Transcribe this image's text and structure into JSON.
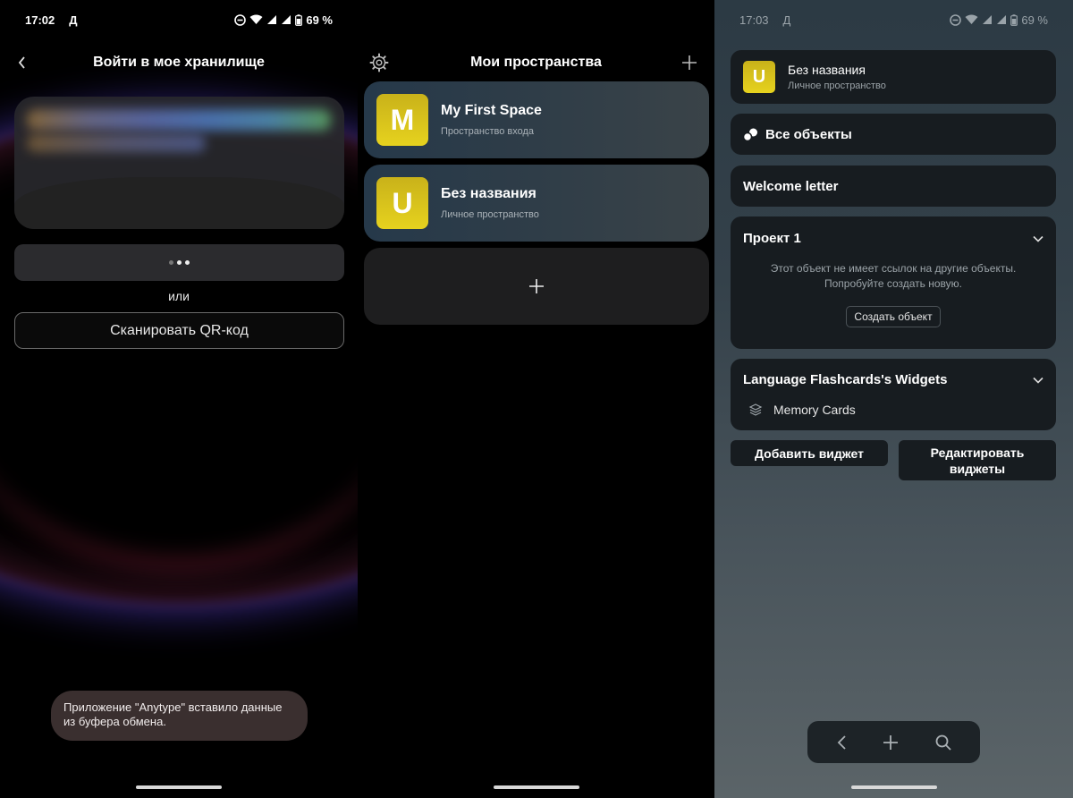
{
  "screen1": {
    "status": {
      "time": "17:02",
      "carrier": "Д",
      "battery": "69 %"
    },
    "header": {
      "title": "Войти в мое хранилище",
      "back_icon": "chevron-left-icon"
    },
    "or_label": "или",
    "qr_button": "Сканировать QR-код",
    "toast": "Приложение \"Anytype\" вставило данные из буфера обмена."
  },
  "screen2": {
    "header": {
      "title": "Мои пространства",
      "settings_icon": "gear-icon",
      "add_icon": "plus-icon"
    },
    "spaces": [
      {
        "letter": "M",
        "name": "My First Space",
        "subtitle": "Пространство входа"
      },
      {
        "letter": "U",
        "name": "Без названия",
        "subtitle": "Личное пространство"
      }
    ],
    "add_space_icon": "plus-icon"
  },
  "screen3": {
    "status": {
      "time": "17:03",
      "carrier": "Д",
      "battery": "69 %"
    },
    "space": {
      "letter": "U",
      "name": "Без названия",
      "subtitle": "Личное пространство"
    },
    "all_objects": "Все объекты",
    "welcome": "Welcome letter",
    "project": {
      "title": "Проект 1",
      "empty_line1": "Этот объект не имеет ссылок на другие объекты.",
      "empty_line2": "Попробуйте создать новую.",
      "create_button": "Создать объект"
    },
    "widgets": {
      "title": "Language Flashcards's Widgets",
      "item": "Memory Cards"
    },
    "add_widget": "Добавить виджет",
    "edit_widgets_line1": "Редактировать",
    "edit_widgets_line2": "виджеты",
    "nav": {
      "back_icon": "chevron-left-icon",
      "add_icon": "plus-icon",
      "search_icon": "search-icon"
    }
  },
  "colors": {
    "accent_avatar": "#e0cb1e",
    "card_bg": "#171c20"
  }
}
